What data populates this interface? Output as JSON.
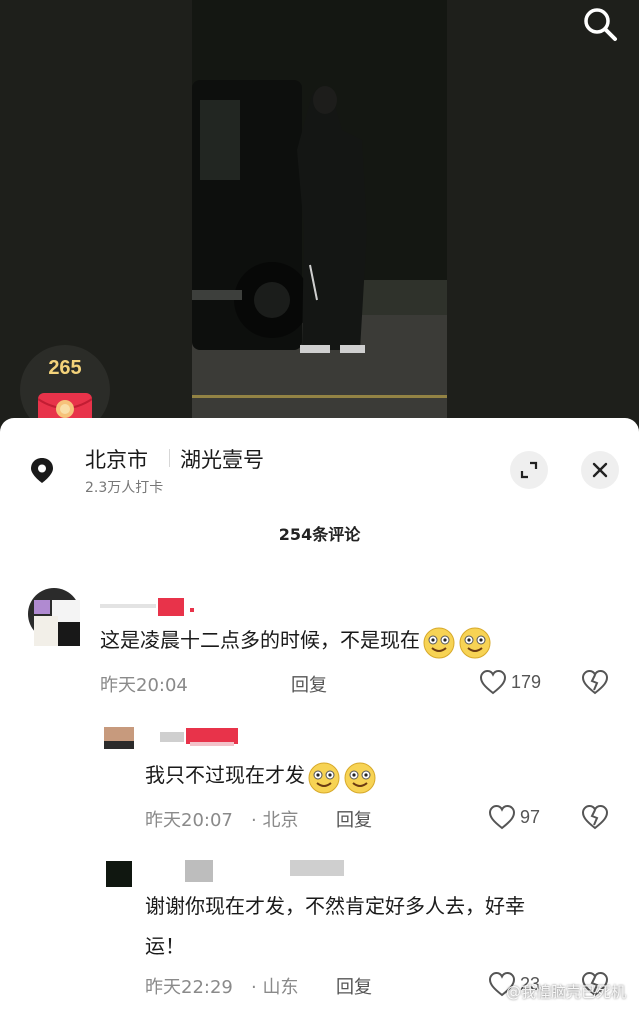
{
  "location": {
    "city": "北京市",
    "place": "湖光壹号",
    "checkins": "2.3万人打卡"
  },
  "badge": {
    "count": "265"
  },
  "comments_header": {
    "count_label": "254条评论"
  },
  "comments": [
    {
      "text": "这是凌晨十二点多的时候，不是现在",
      "time": "昨天20:04",
      "reply_label": "回复",
      "likes": "179"
    },
    {
      "text": "我只不过现在才发",
      "time": "昨天20:07",
      "loc": "· 北京",
      "reply_label": "回复",
      "likes": "97"
    },
    {
      "text_line1": "谢谢你现在才发，不然肯定好多人去，好幸",
      "text_line2": "运！",
      "time": "昨天22:29",
      "loc": "· 山东",
      "reply_label": "回复",
      "likes": "23"
    }
  ],
  "watermark": "@我惶脑壳已死机",
  "colors": {
    "sheet_bg": "#ffffff",
    "accent_red": "#e8334a",
    "badge_gold": "#f3d27a"
  },
  "icons": [
    "search-icon",
    "location-pin-icon",
    "expand-icon",
    "close-icon",
    "heart-icon",
    "broken-heart-icon",
    "red-packet-icon",
    "smile-emoji-icon"
  ]
}
